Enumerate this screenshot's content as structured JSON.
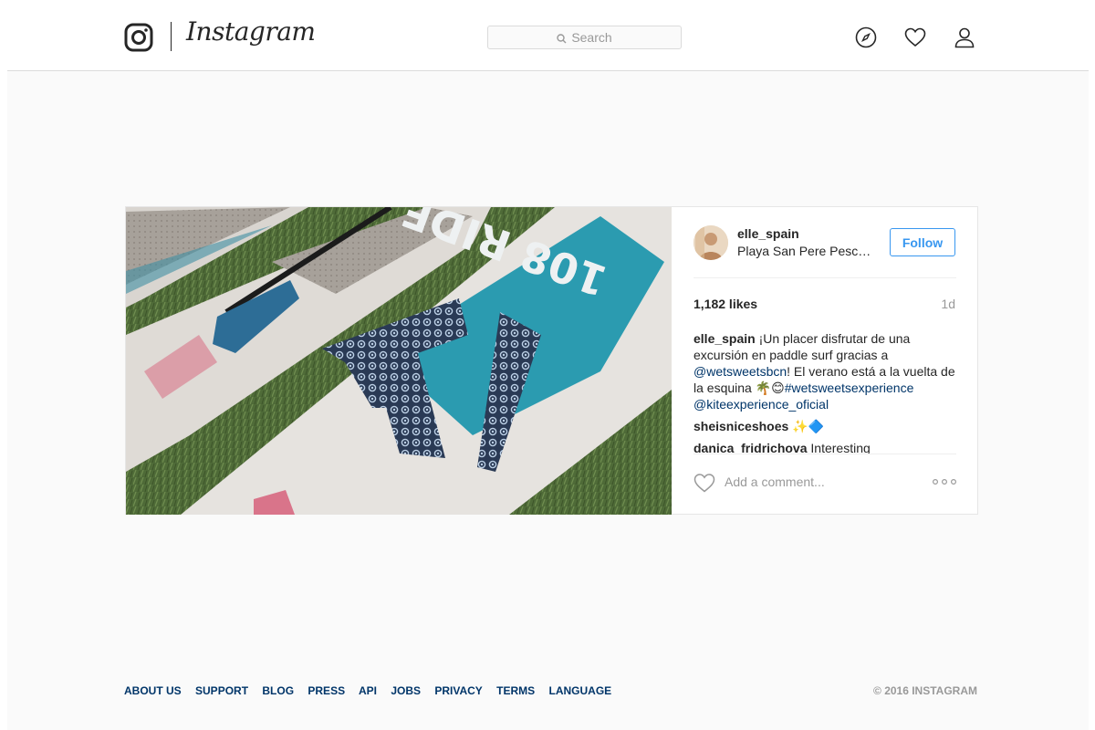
{
  "header": {
    "brand": "Instagram",
    "search_placeholder": "Search",
    "icons": [
      "explore-compass-icon",
      "activity-heart-icon",
      "profile-user-icon"
    ]
  },
  "post": {
    "username": "elle_spain",
    "location": "Playa San Pere Pescador",
    "follow_label": "Follow",
    "likes": "1,182 likes",
    "age": "1d",
    "caption": {
      "user": "elle_spain",
      "text_1": " ¡Un placer disfrutar de una excursión en paddle surf gracias a ",
      "mention_1": "@wetsweetsbcn",
      "text_2": "! El verano está a la vuelta de la esquina 🌴😊",
      "hashtag": "#wetsweetsexperience",
      "mention_2": "@kiteexperience_oficial"
    },
    "comments": [
      {
        "user": "sheisniceshoes",
        "text": " ✨🔷"
      },
      {
        "user": "danica_fridrichova",
        "text": " Interesting"
      }
    ],
    "add_comment_placeholder": "Add a comment...",
    "photo_board_text": "108 RIDE"
  },
  "footer": {
    "links": [
      "ABOUT US",
      "SUPPORT",
      "BLOG",
      "PRESS",
      "API",
      "JOBS",
      "PRIVACY",
      "TERMS",
      "LANGUAGE"
    ],
    "copyright": "© 2016 INSTAGRAM"
  },
  "colors": {
    "accent": "#3897f0",
    "link": "#003569",
    "border": "#dbdbdb",
    "background": "#fafafa",
    "board_teal": "#2b9bb0"
  }
}
